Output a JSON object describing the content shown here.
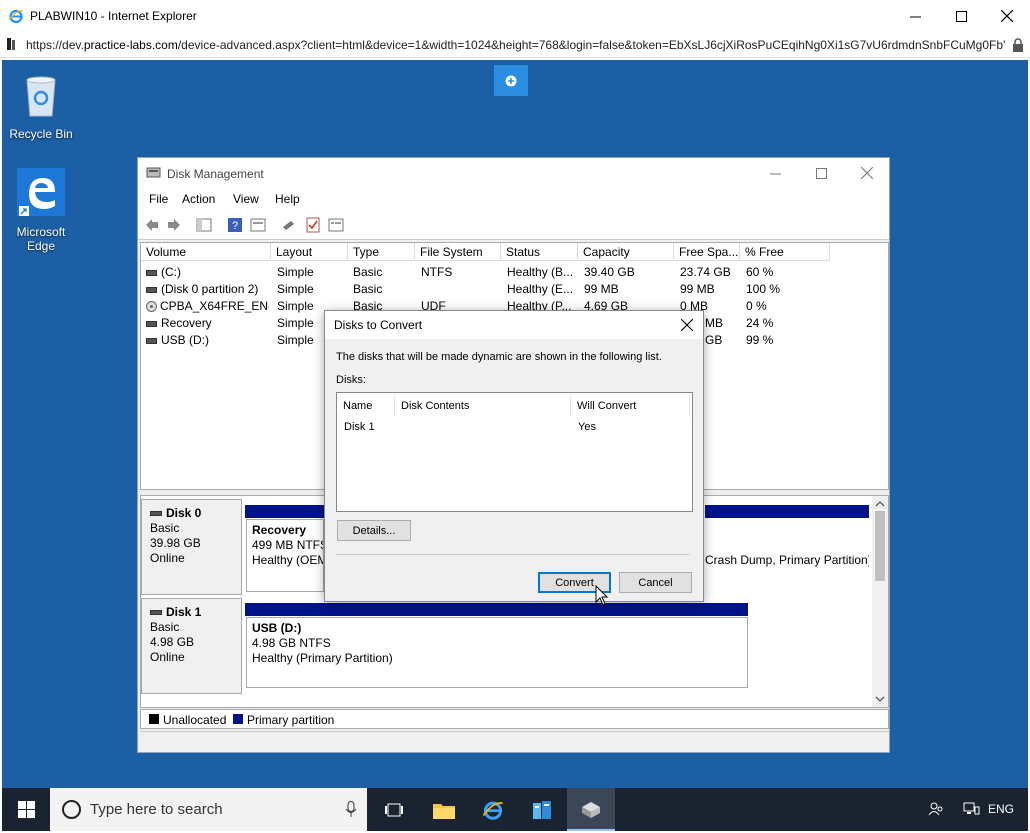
{
  "browser": {
    "title": "PLABWIN10 - Internet Explorer",
    "url_prefix": "https://dev.",
    "url_domain": "practice-labs.com",
    "url_rest": "/device-advanced.aspx?client=html&device=1&width=1024&height=768&login=false&token=EbXsLJ6cjXiRosPuCEqihNg0Xi1sG7vU6rdmdnSnbFCuMg0Fb'"
  },
  "desktop": {
    "icons": [
      {
        "label": "Recycle Bin"
      },
      {
        "label": "Microsoft Edge"
      }
    ]
  },
  "disk_management": {
    "title": "Disk Management",
    "menu": [
      "File",
      "Action",
      "View",
      "Help"
    ],
    "columns": [
      "Volume",
      "Layout",
      "Type",
      "File System",
      "Status",
      "Capacity",
      "Free Spa...",
      "% Free"
    ],
    "volumes": [
      {
        "volume": "(C:)",
        "layout": "Simple",
        "type": "Basic",
        "fs": "NTFS",
        "status": "Healthy (B...",
        "capacity": "39.40 GB",
        "free": "23.74 GB",
        "pct": "60 %"
      },
      {
        "volume": "(Disk 0 partition 2)",
        "layout": "Simple",
        "type": "Basic",
        "fs": "",
        "status": "Healthy (E...",
        "capacity": "99 MB",
        "free": "99 MB",
        "pct": "100 %"
      },
      {
        "volume": "CPBA_X64FRE_EN-...",
        "layout": "Simple",
        "type": "Basic",
        "fs": "UDF",
        "status": "Healthy (P...",
        "capacity": "4.69 GB",
        "free": "0 MB",
        "pct": "0 %"
      },
      {
        "volume": "Recovery",
        "layout": "Simple",
        "type": "",
        "fs": "",
        "status": "",
        "capacity": "",
        "free": "MB",
        "pct": "24 %"
      },
      {
        "volume": "USB (D:)",
        "layout": "Simple",
        "type": "",
        "fs": "",
        "status": "",
        "capacity": "",
        "free": "GB",
        "pct": "99 %"
      }
    ],
    "disks": [
      {
        "name": "Disk 0",
        "type": "Basic",
        "size": "39.98 GB",
        "state": "Online",
        "partition_name": "Recovery",
        "partition_size": "499 MB NTFS",
        "partition_status": "Healthy (OEM",
        "right_text": "Crash Dump, Primary Partition)"
      },
      {
        "name": "Disk 1",
        "type": "Basic",
        "size": "4.98 GB",
        "state": "Online",
        "partition_name": "USB  (D:)",
        "partition_size": "4.98 GB NTFS",
        "partition_status": "Healthy (Primary Partition)"
      }
    ],
    "legend": [
      {
        "label": "Unallocated",
        "color": "#000000"
      },
      {
        "label": "Primary partition",
        "color": "#001389"
      }
    ]
  },
  "dialog": {
    "title": "Disks to Convert",
    "description": "The disks that will be made dynamic are shown in the following list.",
    "disks_label": "Disks:",
    "table_headers": [
      "Name",
      "Disk Contents",
      "Will Convert"
    ],
    "rows": [
      {
        "name": "Disk 1",
        "contents": "",
        "will_convert": "Yes"
      }
    ],
    "details_button": "Details...",
    "convert_button": "Convert",
    "cancel_button": "Cancel"
  },
  "taskbar": {
    "search_placeholder": "Type here to search",
    "language": "ENG"
  }
}
